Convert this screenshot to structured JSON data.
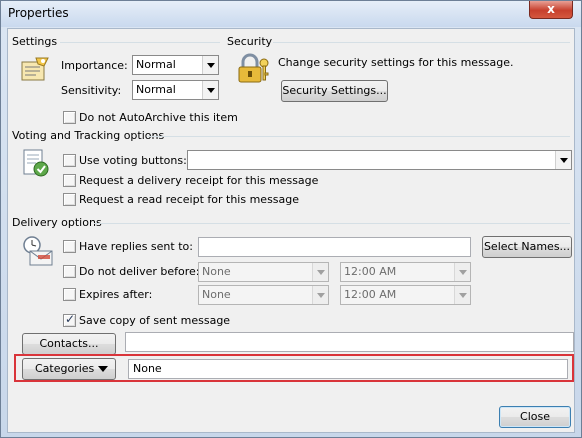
{
  "window": {
    "title": "Properties",
    "close_glyph": "x"
  },
  "settings": {
    "heading": "Settings",
    "importance_label": "Importance:",
    "importance_value": "Normal",
    "sensitivity_label": "Sensitivity:",
    "sensitivity_value": "Normal",
    "autoarchive_label": "Do not AutoArchive this item",
    "autoarchive_checked": false,
    "icon": "message-settings-icon"
  },
  "security": {
    "heading": "Security",
    "description": "Change security settings for this message.",
    "button_label": "Security Settings...",
    "icon": "padlock-key-icon"
  },
  "voting": {
    "heading": "Voting and Tracking options",
    "icon": "voting-form-icon",
    "use_voting_label": "Use voting buttons:",
    "use_voting_checked": false,
    "voting_value": "",
    "delivery_receipt_label": "Request a delivery receipt for this message",
    "delivery_receipt_checked": false,
    "read_receipt_label": "Request a read receipt for this message",
    "read_receipt_checked": false
  },
  "delivery": {
    "heading": "Delivery options",
    "icon": "clock-envelope-icon",
    "replies_label": "Have replies sent to:",
    "replies_checked": false,
    "replies_value": "",
    "select_names_label": "Select Names...",
    "not_before_label": "Do not deliver before:",
    "not_before_checked": false,
    "not_before_date": "None",
    "not_before_time": "12:00 AM",
    "expires_label": "Expires after:",
    "expires_checked": false,
    "expires_date": "None",
    "expires_time": "12:00 AM",
    "save_copy_label": "Save copy of sent message",
    "save_copy_checked": true
  },
  "contacts": {
    "button_label": "Contacts...",
    "value": ""
  },
  "categories": {
    "button_label": "Categories",
    "value": "None",
    "highlight_color": "#d9343a"
  },
  "footer": {
    "close_label": "Close"
  }
}
